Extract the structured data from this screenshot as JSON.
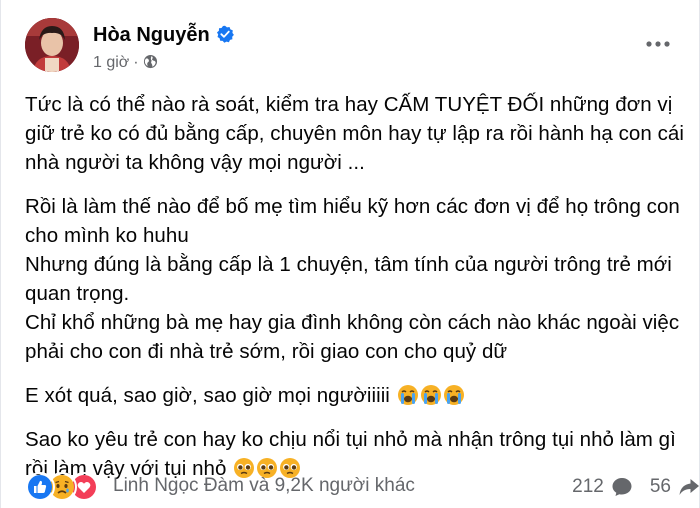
{
  "author": {
    "name": "Hòa Nguyễn",
    "time": "1 giờ",
    "separator": "·"
  },
  "post": {
    "paragraphs": [
      "Tức là có thể nào rà soát, kiểm tra hay CẤM TUYỆT ĐỐI những đơn vị giữ trẻ ko có đủ bằng cấp, chuyên môn hay tự lập ra rồi hành hạ con cái nhà người ta không vậy mọi người ...",
      "Rồi là làm thế nào để bố mẹ tìm hiểu kỹ hơn các đơn vị để họ trông con cho mình ko huhu\nNhưng đúng là bằng cấp là 1 chuyện, tâm tính của người trông trẻ mới quan trọng.\nChỉ khổ những bà mẹ hay gia đình không còn cách nào khác ngoài việc phải cho con đi nhà trẻ sớm, rồi giao con cho quỷ dữ",
      "E xót quá, sao giờ, sao giờ mọi ngườiiiii",
      "Sao ko yêu trẻ con hay ko chịu nổi tụi nhỏ mà nhận trông tụi nhỏ làm gì rồi làm vậy với tụi nhỏ"
    ]
  },
  "reactions": {
    "summary": "Linh Ngọc Đàm và 9,2K người khác",
    "types": [
      "like",
      "sad",
      "love"
    ],
    "comments_count": "212",
    "shares_count": "56"
  },
  "colors": {
    "like": "#1877f2",
    "love": "#f33e58",
    "sad": "#f7b125",
    "secondary_text": "#65676b"
  }
}
